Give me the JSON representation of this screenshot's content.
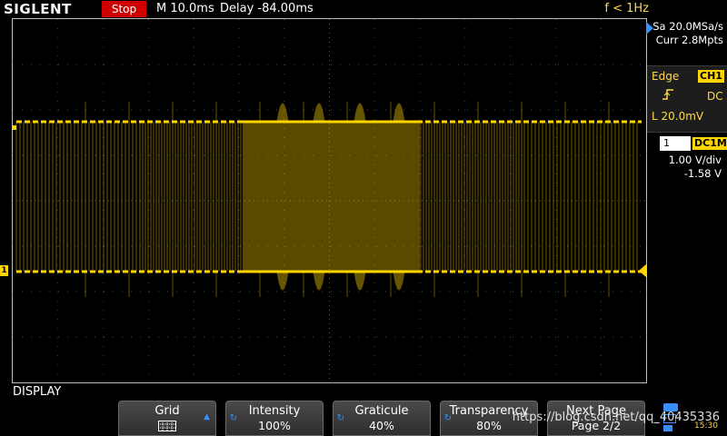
{
  "top_bar": {
    "logo": "SIGLENT",
    "run_state": "Stop",
    "timebase": "M 10.0ms",
    "delay": "Delay -84.00ms",
    "trigger_freq": "f < 1Hz"
  },
  "acquisition": {
    "sample_rate": "Sa 20.0MSa/s",
    "memory_depth": "Curr 2.8Mpts"
  },
  "trigger": {
    "type": "Edge",
    "source": "CH1",
    "slope_icon": "rising-edge-icon",
    "coupling": "DC",
    "level": "L  20.0mV"
  },
  "channel": {
    "number": "1",
    "coupling": "DC1M",
    "scale": "1.00 V/div",
    "offset": "-1.58 V",
    "marker": "1"
  },
  "menu": {
    "title": "DISPLAY",
    "buttons": [
      {
        "label": "Grid",
        "value": ""
      },
      {
        "label": "Intensity",
        "value": "100%"
      },
      {
        "label": "Graticule",
        "value": "40%"
      },
      {
        "label": "Transparency",
        "value": "80%"
      },
      {
        "label": "Next Page",
        "value": "Page 2/2"
      }
    ]
  },
  "status": {
    "time": "15:30"
  },
  "watermark": "https://blog.csdn.net/qq_40435336",
  "colors": {
    "channel1": "#ffd500",
    "stop": "#d00000",
    "trigger_text": "#ffd84a"
  }
}
